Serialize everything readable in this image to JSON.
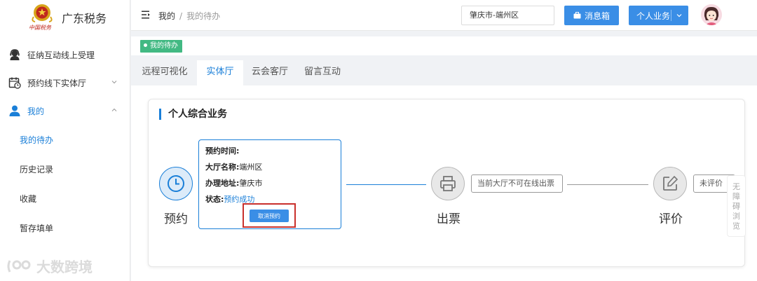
{
  "app": {
    "logo_text": "广东税务",
    "emblem_caption": "中国税务"
  },
  "sidebar": {
    "items": [
      {
        "label": "征纳互动线上受理",
        "icon": "headset-icon"
      },
      {
        "label": "预约线下实体厅",
        "icon": "calendar-icon"
      },
      {
        "label": "我的",
        "icon": "user-icon"
      }
    ],
    "sub_items": [
      {
        "label": "我的待办",
        "active": true
      },
      {
        "label": "历史记录"
      },
      {
        "label": "收藏"
      },
      {
        "label": "暂存填单"
      }
    ]
  },
  "header": {
    "breadcrumb_root": "我的",
    "breadcrumb_separator": "/",
    "breadcrumb_current": "我的待办",
    "city": "肇庆市-端州区",
    "message_button": "消息箱",
    "personal_button": "个人业务"
  },
  "tagbar": {
    "tag_label": "我的待办",
    "tag_color": "#42b983"
  },
  "tabs": [
    {
      "label": "远程可视化"
    },
    {
      "label": "实体厅",
      "active": true
    },
    {
      "label": "云会客厅"
    },
    {
      "label": "留言互动"
    }
  ],
  "card": {
    "title": "个人综合业务",
    "steps": [
      {
        "label": "预约",
        "icon": "clock-icon"
      },
      {
        "label": "出票",
        "icon": "printer-icon"
      },
      {
        "label": "评价",
        "icon": "edit-icon"
      }
    ],
    "appointment": {
      "time_label": "预约时间:",
      "time_value": "",
      "hall_label": "大厅名称:",
      "hall_value": "端州区",
      "address_label": "办理地址:",
      "address_value": "肇庆市",
      "status_label": "状态:",
      "status_value": "预约成功",
      "cancel_button": "取消预约"
    },
    "ticket_note": "当前大厅不可在线出票",
    "evaluation_note": "未评价"
  },
  "accessibility": "无障碍浏览",
  "watermark": "大数跨境",
  "colors": {
    "accent": "#1a7fd8",
    "button": "#3a8ee6",
    "highlight_border": "#c9302c"
  }
}
